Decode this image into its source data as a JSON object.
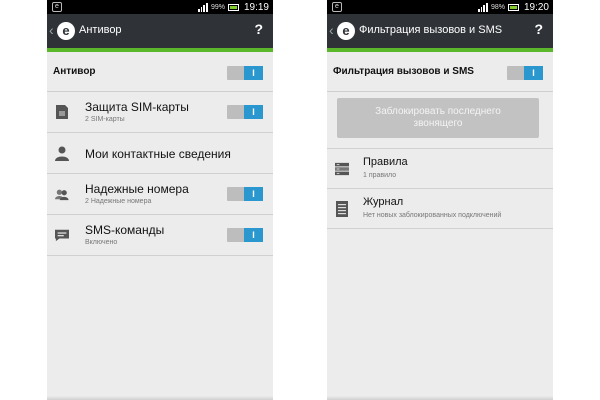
{
  "left": {
    "status": {
      "battery": "99%",
      "time": "19:19",
      "app_badge": "e"
    },
    "header": {
      "logo": "e",
      "title": "Антивор",
      "help": "?"
    },
    "master": {
      "label": "Антивор",
      "toggle": "I"
    },
    "items": [
      {
        "icon": "sim-card-icon",
        "title": "Защита SIM-карты",
        "sub": "2 SIM-карты",
        "toggle": "I"
      },
      {
        "icon": "person-icon",
        "title": "Мои контактные сведения"
      },
      {
        "icon": "contacts-group-icon",
        "title": "Надежные номера",
        "sub": "2 Надежные номера",
        "toggle": "I"
      },
      {
        "icon": "sms-message-icon",
        "title": "SMS-команды",
        "sub": "Включено",
        "toggle": "I"
      }
    ]
  },
  "right": {
    "status": {
      "battery": "98%",
      "time": "19:20",
      "app_badge": "e"
    },
    "header": {
      "logo": "e",
      "title": "Фильтрация вызовов и SMS",
      "help": "?"
    },
    "master": {
      "label": "Фильтрация вызовов и SMS",
      "toggle": "I"
    },
    "block_button": "Заблокировать последнего звонящего",
    "items": [
      {
        "icon": "rules-list-icon",
        "title": "Правила",
        "sub": "1 правило"
      },
      {
        "icon": "log-document-icon",
        "title": "Журнал",
        "sub": "Нет новых заблокированных подключений"
      }
    ]
  },
  "colors": {
    "accent_green": "#5bb82a",
    "toggle_blue": "#2a98cf",
    "action_bar": "#2f3338"
  }
}
